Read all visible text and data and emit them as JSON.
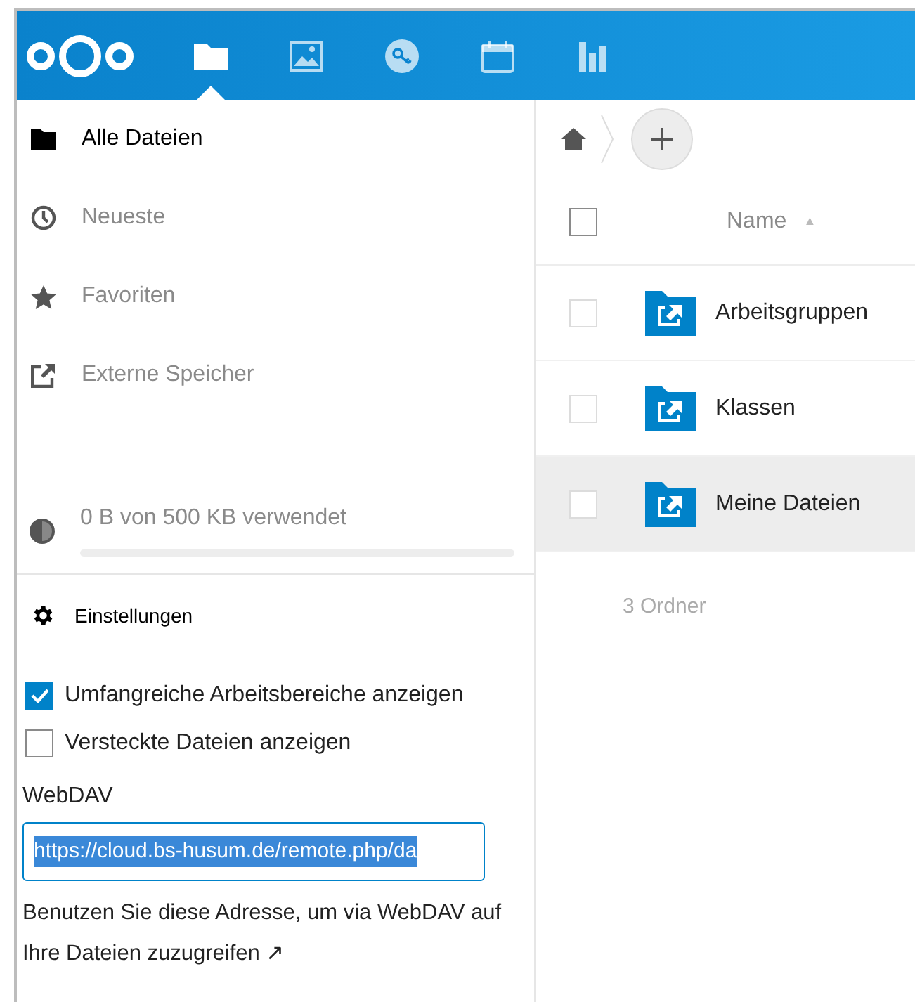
{
  "header": {
    "apps": [
      {
        "kind": "files",
        "selected": true
      },
      {
        "kind": "photos",
        "selected": false
      },
      {
        "kind": "passwords",
        "selected": false
      },
      {
        "kind": "calendar",
        "selected": false
      },
      {
        "kind": "activity",
        "selected": false
      }
    ]
  },
  "navigation": [
    {
      "kind": "folder",
      "label": "Alle Dateien",
      "selected": true
    },
    {
      "kind": "clock",
      "label": "Neueste",
      "selected": false
    },
    {
      "kind": "star",
      "label": "Favoriten",
      "selected": false
    },
    {
      "kind": "external",
      "label": "Externe Speicher",
      "selected": false
    }
  ],
  "quota": {
    "text": "0 B von 500 KB verwendet",
    "level": 0
  },
  "settings": {
    "title": "Einstellungen",
    "options": [
      {
        "label": "Umfangreiche Arbeitsbereiche anzeigen",
        "checked": true
      },
      {
        "label": "Versteckte Dateien anzeigen",
        "checked": false
      }
    ],
    "webdav_label": "WebDAV",
    "webdav_url": "https://cloud.bs-husum.de/remote.php/da",
    "webdav_hint": "Benutzen Sie diese Adresse, um via WebDAV auf Ihre Dateien zuzugreifen ↗"
  },
  "file_list": {
    "select_all_checked": false,
    "column": "Name",
    "sort_indicator": "▲",
    "rows": [
      {
        "name": "Arbeitsgruppen",
        "checked": false,
        "selected": false
      },
      {
        "name": "Klassen",
        "checked": false,
        "selected": false
      },
      {
        "name": "Meine Dateien",
        "checked": false,
        "selected": true
      }
    ],
    "summary": "3 Ordner"
  }
}
